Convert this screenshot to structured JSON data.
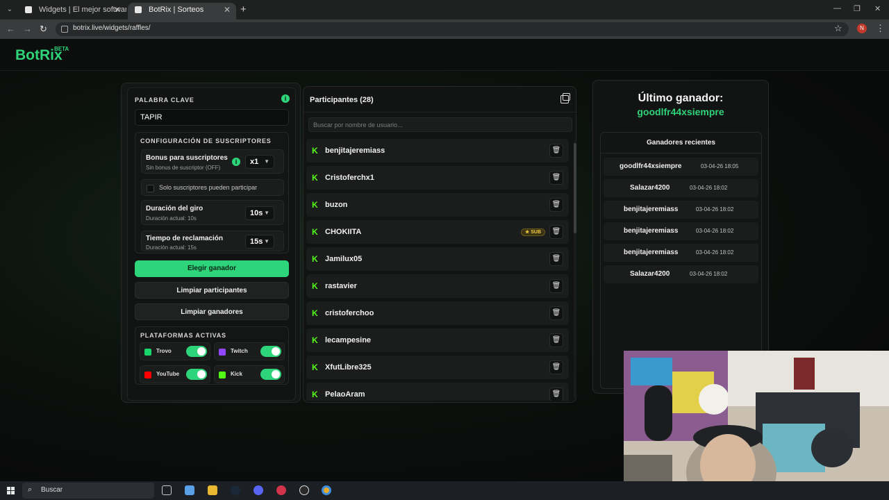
{
  "browser": {
    "tabs": [
      {
        "title": "Widgets | El mejor software pa",
        "active": false
      },
      {
        "title": "BotRix | Sorteos",
        "active": true
      }
    ],
    "url": "botrix.live/widgets/raffles/",
    "profile_initial": "N"
  },
  "header": {
    "logo": "BotRix",
    "badge": "BETA"
  },
  "left": {
    "keyword_label": "PALABRA CLAVE",
    "keyword_value": "TAPIR",
    "sub_config_title": "CONFIGURACIÓN DE SUSCRIPTORES",
    "bonus_title": "Bonus para suscriptores",
    "bonus_sub": "Sin bonus de suscriptor (OFF)",
    "bonus_value": "x1",
    "sub_only_label": "Solo suscriptores pueden participar",
    "spin_title": "Duración del giro",
    "spin_sub": "Duración actual: 10s",
    "spin_value": "10s",
    "claim_title": "Tiempo de reclamación",
    "claim_sub": "Duración actual: 15s",
    "claim_value": "15s",
    "pick_winner": "Elegir ganador",
    "clear_participants": "Limpiar participantes",
    "clear_winners": "Limpiar ganadores",
    "platforms_title": "PLATAFORMAS ACTIVAS",
    "platforms": [
      {
        "name": "Trovo",
        "enabled": true,
        "color": "#19d66b"
      },
      {
        "name": "Twitch",
        "enabled": true,
        "color": "#9146ff"
      },
      {
        "name": "YouTube",
        "enabled": true,
        "color": "#ff0000"
      },
      {
        "name": "Kick",
        "enabled": true,
        "color": "#53fc18"
      }
    ]
  },
  "participants": {
    "title": "Participantes (28)",
    "search_placeholder": "Buscar por nombre de usuario...",
    "sub_badge": "★ SUB",
    "list": [
      {
        "name": "benjitajeremiass",
        "platform": "kick",
        "sub": false
      },
      {
        "name": "Cristoferchx1",
        "platform": "kick",
        "sub": false
      },
      {
        "name": "buzon",
        "platform": "kick",
        "sub": false
      },
      {
        "name": "CHOKIITA",
        "platform": "kick",
        "sub": true
      },
      {
        "name": "Jamilux05",
        "platform": "kick",
        "sub": false
      },
      {
        "name": "rastavier",
        "platform": "kick",
        "sub": false
      },
      {
        "name": "cristoferchoo",
        "platform": "kick",
        "sub": false
      },
      {
        "name": "lecampesine",
        "platform": "kick",
        "sub": false
      },
      {
        "name": "XfutLibre325",
        "platform": "kick",
        "sub": false
      },
      {
        "name": "PelaoAram",
        "platform": "kick",
        "sub": false
      }
    ]
  },
  "winner": {
    "title": "Último ganador:",
    "name": "goodlfr44xsiempre",
    "recent_title": "Ganadores recientes",
    "recent": [
      {
        "name": "goodlfr44xsiempre",
        "date": "03-04-26 18:05"
      },
      {
        "name": "Salazar4200",
        "date": "03-04-26 18:02"
      },
      {
        "name": "benjitajeremiass",
        "date": "03-04-26 18:02"
      },
      {
        "name": "benjitajeremiass",
        "date": "03-04-26 18:02"
      },
      {
        "name": "benjitajeremiass",
        "date": "03-04-26 18:02"
      },
      {
        "name": "Salazar4200",
        "date": "03-04-26 18:02"
      }
    ]
  },
  "taskbar": {
    "search_label": "Buscar"
  },
  "colors": {
    "accent": "#2ed47a",
    "kick": "#53fc18"
  }
}
